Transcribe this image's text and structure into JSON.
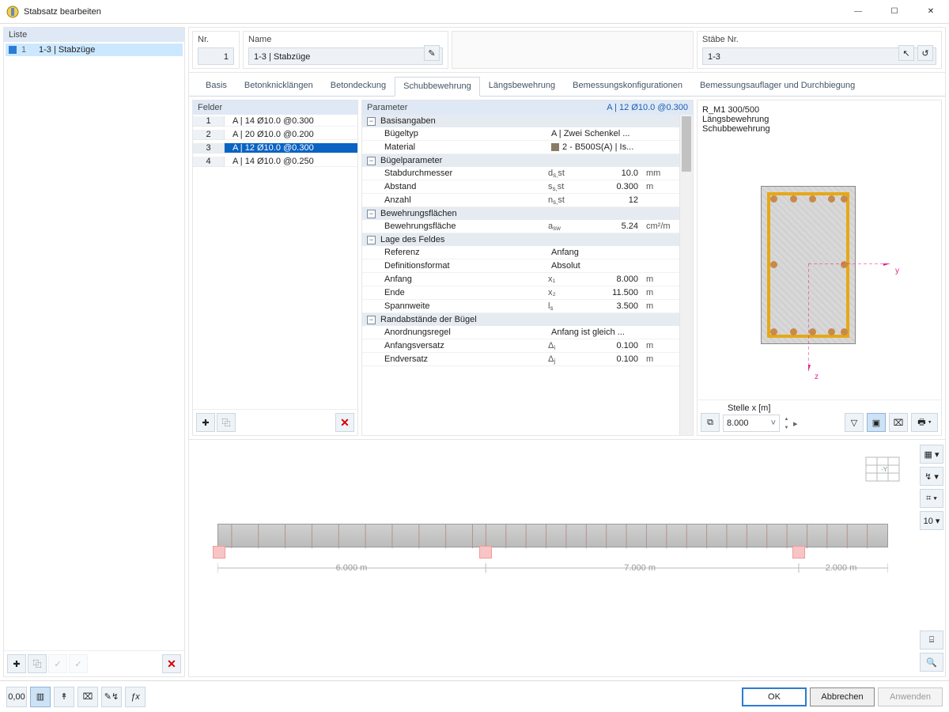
{
  "window": {
    "title": "Stabsatz bearbeiten"
  },
  "win_buttons": [
    "—",
    "☐",
    "✕"
  ],
  "sidebar": {
    "header": "Liste",
    "items": [
      {
        "num": "1",
        "label": "1-3 | Stabzüge"
      }
    ],
    "toolbar": {
      "new": "✚",
      "dup": "⿻",
      "check1": "✓",
      "check2": "✓",
      "delete": "✕"
    }
  },
  "top": {
    "nr": {
      "label": "Nr.",
      "value": "1"
    },
    "name": {
      "label": "Name",
      "value": "1-3 | Stabzüge",
      "edit": "✎"
    },
    "stabe": {
      "label": "Stäbe Nr.",
      "value": "1-3",
      "pick": "↖",
      "reset": "↺"
    }
  },
  "tabs": [
    "Basis",
    "Betonknicklängen",
    "Betondeckung",
    "Schubbewehrung",
    "Längsbewehrung",
    "Bemessungskonfigurationen",
    "Bemessungsauflager und Durchbiegung"
  ],
  "tabs_active": 3,
  "felder": {
    "header": "Felder",
    "rows": [
      {
        "idx": "1",
        "label": "A | 14 Ø10.0 @0.300"
      },
      {
        "idx": "2",
        "label": "A | 20 Ø10.0 @0.200"
      },
      {
        "idx": "3",
        "label": "A | 12 Ø10.0 @0.300",
        "selected": true
      },
      {
        "idx": "4",
        "label": "A | 14 Ø10.0 @0.250"
      }
    ],
    "toolbar": {
      "new": "✚",
      "dup": "⿻",
      "delete": "✕"
    }
  },
  "param": {
    "header": "Parameter",
    "header_right": "A | 12 Ø10.0 @0.300",
    "groups": [
      {
        "title": "Basisangaben",
        "rows": [
          {
            "k": "Bügeltyp",
            "wide": "A | Zwei Schenkel ..."
          },
          {
            "k": "Material",
            "swatch": true,
            "wide": "2 - B500S(A) | Is..."
          }
        ]
      },
      {
        "title": "Bügelparameter",
        "rows": [
          {
            "k": "Stabdurchmesser",
            "sym": "d_s,st",
            "v": "10.0",
            "u": "mm"
          },
          {
            "k": "Abstand",
            "sym": "s_s,st",
            "v": "0.300",
            "u": "m"
          },
          {
            "k": "Anzahl",
            "sym": "n_s,st",
            "v": "12",
            "u": ""
          }
        ]
      },
      {
        "title": "Bewehrungsflächen",
        "rows": [
          {
            "k": "Bewehrungsfläche",
            "sym": "a_sw",
            "v": "5.24",
            "u": "cm²/m"
          }
        ]
      },
      {
        "title": "Lage des Feldes",
        "rows": [
          {
            "k": "Referenz",
            "wide": "Anfang"
          },
          {
            "k": "Definitionsformat",
            "wide": "Absolut"
          },
          {
            "k": "Anfang",
            "sym": "x₁",
            "v": "8.000",
            "u": "m"
          },
          {
            "k": "Ende",
            "sym": "x₂",
            "v": "11.500",
            "u": "m"
          },
          {
            "k": "Spannweite",
            "sym": "l_s",
            "v": "3.500",
            "u": "m"
          }
        ]
      },
      {
        "title": "Randabstände der Bügel",
        "rows": [
          {
            "k": "Anordnungsregel",
            "wide": "Anfang ist gleich ..."
          },
          {
            "k": "Anfangsversatz",
            "sym": "Δ_i",
            "v": "0.100",
            "u": "m"
          },
          {
            "k": "Endversatz",
            "sym": "Δ_j",
            "v": "0.100",
            "u": "m"
          }
        ]
      }
    ]
  },
  "section": {
    "title": "R_M1 300/500",
    "line1": "Längsbewehrung",
    "line2": "Schubbewehrung",
    "axis_y": "y",
    "axis_z": "z",
    "stelle_label": "Stelle x [m]",
    "stelle_value": "8.000",
    "tool_layer": "⧉",
    "tool_filter": "▽",
    "tool_crop": "▣",
    "tool_plot": "⌧",
    "tool_print": "🖶 ▾"
  },
  "gridpanel": {
    "dims": [
      "6.000 m",
      "7.000 m",
      "2.000 m"
    ],
    "side": [
      "▦ ▾",
      "↯ ▾",
      "⌗ ▾",
      "10 ▾",
      "⌸",
      "🔍"
    ]
  },
  "footer": {
    "tools": [
      "0,00",
      "▥",
      "↟",
      "⌧",
      "✎↯",
      "ƒx"
    ],
    "ok": "OK",
    "cancel": "Abbrechen",
    "apply": "Anwenden"
  }
}
